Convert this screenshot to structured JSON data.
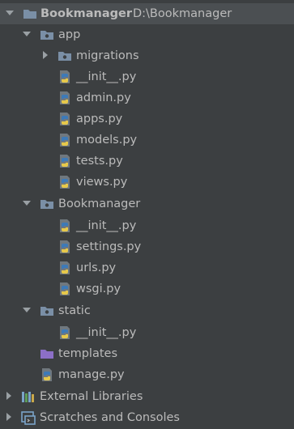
{
  "colors": {
    "background": "#3c3f41",
    "text": "#bbbbbb",
    "folder": "#7a8fa6",
    "templates_folder": "#8c6fc7",
    "python_blue": "#3d7ab8",
    "python_yellow": "#e6c84a"
  },
  "tree": {
    "root": {
      "label": "Bookmanager",
      "path": "D:\\Bookmanager",
      "expanded": true,
      "icon": "folder-icon"
    },
    "app": {
      "label": "app",
      "expanded": true,
      "icon": "package-folder-icon",
      "children": {
        "migrations": {
          "label": "migrations",
          "expanded": false,
          "icon": "package-folder-icon"
        },
        "init": {
          "label": "__init__.py",
          "icon": "python-file-icon"
        },
        "admin": {
          "label": "admin.py",
          "icon": "python-file-icon"
        },
        "apps": {
          "label": "apps.py",
          "icon": "python-file-icon"
        },
        "models": {
          "label": "models.py",
          "icon": "python-file-icon"
        },
        "tests": {
          "label": "tests.py",
          "icon": "python-file-icon"
        },
        "views": {
          "label": "views.py",
          "icon": "python-file-icon"
        }
      }
    },
    "bookmanager_pkg": {
      "label": "Bookmanager",
      "expanded": true,
      "icon": "package-folder-icon",
      "children": {
        "init": {
          "label": "__init__.py",
          "icon": "python-file-icon"
        },
        "settings": {
          "label": "settings.py",
          "icon": "python-file-icon"
        },
        "urls": {
          "label": "urls.py",
          "icon": "python-file-icon"
        },
        "wsgi": {
          "label": "wsgi.py",
          "icon": "python-file-icon"
        }
      }
    },
    "static": {
      "label": "static",
      "expanded": true,
      "icon": "package-folder-icon",
      "children": {
        "init": {
          "label": "__init__.py",
          "icon": "python-file-icon"
        }
      }
    },
    "templates": {
      "label": "templates",
      "icon": "templates-folder-icon"
    },
    "manage": {
      "label": "manage.py",
      "icon": "python-file-icon"
    },
    "external_libraries": {
      "label": "External Libraries",
      "expanded": false,
      "icon": "libraries-icon"
    },
    "scratches": {
      "label": "Scratches and Consoles",
      "expanded": false,
      "icon": "scratches-icon"
    }
  }
}
